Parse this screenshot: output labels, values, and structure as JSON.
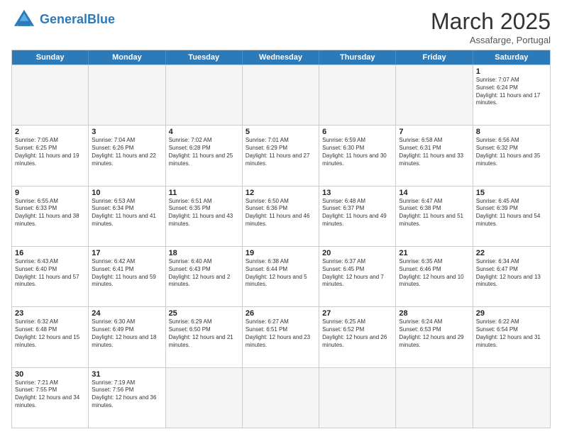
{
  "header": {
    "logo_general": "General",
    "logo_blue": "Blue",
    "month": "March 2025",
    "location": "Assafarge, Portugal"
  },
  "days_of_week": [
    "Sunday",
    "Monday",
    "Tuesday",
    "Wednesday",
    "Thursday",
    "Friday",
    "Saturday"
  ],
  "rows": [
    [
      {
        "day": "",
        "info": ""
      },
      {
        "day": "",
        "info": ""
      },
      {
        "day": "",
        "info": ""
      },
      {
        "day": "",
        "info": ""
      },
      {
        "day": "",
        "info": ""
      },
      {
        "day": "",
        "info": ""
      },
      {
        "day": "1",
        "info": "Sunrise: 7:07 AM\nSunset: 6:24 PM\nDaylight: 11 hours and 17 minutes."
      }
    ],
    [
      {
        "day": "2",
        "info": "Sunrise: 7:05 AM\nSunset: 6:25 PM\nDaylight: 11 hours and 19 minutes."
      },
      {
        "day": "3",
        "info": "Sunrise: 7:04 AM\nSunset: 6:26 PM\nDaylight: 11 hours and 22 minutes."
      },
      {
        "day": "4",
        "info": "Sunrise: 7:02 AM\nSunset: 6:28 PM\nDaylight: 11 hours and 25 minutes."
      },
      {
        "day": "5",
        "info": "Sunrise: 7:01 AM\nSunset: 6:29 PM\nDaylight: 11 hours and 27 minutes."
      },
      {
        "day": "6",
        "info": "Sunrise: 6:59 AM\nSunset: 6:30 PM\nDaylight: 11 hours and 30 minutes."
      },
      {
        "day": "7",
        "info": "Sunrise: 6:58 AM\nSunset: 6:31 PM\nDaylight: 11 hours and 33 minutes."
      },
      {
        "day": "8",
        "info": "Sunrise: 6:56 AM\nSunset: 6:32 PM\nDaylight: 11 hours and 35 minutes."
      }
    ],
    [
      {
        "day": "9",
        "info": "Sunrise: 6:55 AM\nSunset: 6:33 PM\nDaylight: 11 hours and 38 minutes."
      },
      {
        "day": "10",
        "info": "Sunrise: 6:53 AM\nSunset: 6:34 PM\nDaylight: 11 hours and 41 minutes."
      },
      {
        "day": "11",
        "info": "Sunrise: 6:51 AM\nSunset: 6:35 PM\nDaylight: 11 hours and 43 minutes."
      },
      {
        "day": "12",
        "info": "Sunrise: 6:50 AM\nSunset: 6:36 PM\nDaylight: 11 hours and 46 minutes."
      },
      {
        "day": "13",
        "info": "Sunrise: 6:48 AM\nSunset: 6:37 PM\nDaylight: 11 hours and 49 minutes."
      },
      {
        "day": "14",
        "info": "Sunrise: 6:47 AM\nSunset: 6:38 PM\nDaylight: 11 hours and 51 minutes."
      },
      {
        "day": "15",
        "info": "Sunrise: 6:45 AM\nSunset: 6:39 PM\nDaylight: 11 hours and 54 minutes."
      }
    ],
    [
      {
        "day": "16",
        "info": "Sunrise: 6:43 AM\nSunset: 6:40 PM\nDaylight: 11 hours and 57 minutes."
      },
      {
        "day": "17",
        "info": "Sunrise: 6:42 AM\nSunset: 6:41 PM\nDaylight: 11 hours and 59 minutes."
      },
      {
        "day": "18",
        "info": "Sunrise: 6:40 AM\nSunset: 6:43 PM\nDaylight: 12 hours and 2 minutes."
      },
      {
        "day": "19",
        "info": "Sunrise: 6:38 AM\nSunset: 6:44 PM\nDaylight: 12 hours and 5 minutes."
      },
      {
        "day": "20",
        "info": "Sunrise: 6:37 AM\nSunset: 6:45 PM\nDaylight: 12 hours and 7 minutes."
      },
      {
        "day": "21",
        "info": "Sunrise: 6:35 AM\nSunset: 6:46 PM\nDaylight: 12 hours and 10 minutes."
      },
      {
        "day": "22",
        "info": "Sunrise: 6:34 AM\nSunset: 6:47 PM\nDaylight: 12 hours and 13 minutes."
      }
    ],
    [
      {
        "day": "23",
        "info": "Sunrise: 6:32 AM\nSunset: 6:48 PM\nDaylight: 12 hours and 15 minutes."
      },
      {
        "day": "24",
        "info": "Sunrise: 6:30 AM\nSunset: 6:49 PM\nDaylight: 12 hours and 18 minutes."
      },
      {
        "day": "25",
        "info": "Sunrise: 6:29 AM\nSunset: 6:50 PM\nDaylight: 12 hours and 21 minutes."
      },
      {
        "day": "26",
        "info": "Sunrise: 6:27 AM\nSunset: 6:51 PM\nDaylight: 12 hours and 23 minutes."
      },
      {
        "day": "27",
        "info": "Sunrise: 6:25 AM\nSunset: 6:52 PM\nDaylight: 12 hours and 26 minutes."
      },
      {
        "day": "28",
        "info": "Sunrise: 6:24 AM\nSunset: 6:53 PM\nDaylight: 12 hours and 29 minutes."
      },
      {
        "day": "29",
        "info": "Sunrise: 6:22 AM\nSunset: 6:54 PM\nDaylight: 12 hours and 31 minutes."
      }
    ],
    [
      {
        "day": "30",
        "info": "Sunrise: 7:21 AM\nSunset: 7:55 PM\nDaylight: 12 hours and 34 minutes."
      },
      {
        "day": "31",
        "info": "Sunrise: 7:19 AM\nSunset: 7:56 PM\nDaylight: 12 hours and 36 minutes."
      },
      {
        "day": "",
        "info": ""
      },
      {
        "day": "",
        "info": ""
      },
      {
        "day": "",
        "info": ""
      },
      {
        "day": "",
        "info": ""
      },
      {
        "day": "",
        "info": ""
      }
    ]
  ]
}
